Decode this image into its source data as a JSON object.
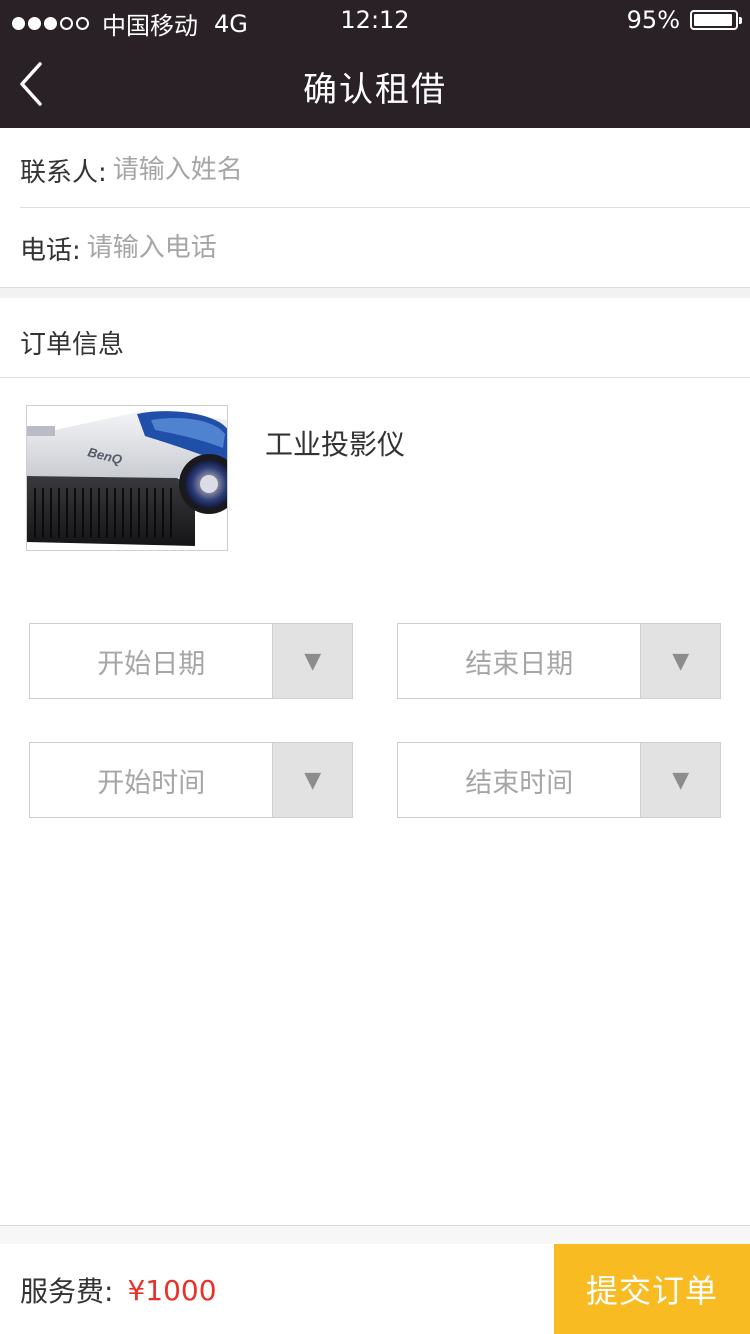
{
  "status_bar": {
    "carrier": "中国移动",
    "network": "4G",
    "time": "12:12",
    "battery": "95%",
    "battery_level": 0.95
  },
  "nav": {
    "title": "确认租借",
    "back_icon": "chevron-left-icon"
  },
  "contact_form": {
    "contact_label": "联系人:",
    "contact_placeholder": "请输入姓名",
    "phone_label": "电话:",
    "phone_placeholder": "请输入电话"
  },
  "order": {
    "section_title": "订单信息",
    "product_name": "工业投影仪",
    "product_image_brand": "BenQ"
  },
  "pickers": {
    "start_date": "开始日期",
    "end_date": "结束日期",
    "start_time": "开始时间",
    "end_time": "结束时间",
    "arrow_glyph": "▼",
    "arrow_icon": "triangle-down-icon"
  },
  "footer": {
    "fee_label": "服务费:",
    "fee_value": "¥1000",
    "submit_label": "提交订单"
  },
  "colors": {
    "header_bg": "#2a2126",
    "accent": "#f8bb21",
    "price": "#e8312a",
    "placeholder": "#a6a6a6"
  }
}
